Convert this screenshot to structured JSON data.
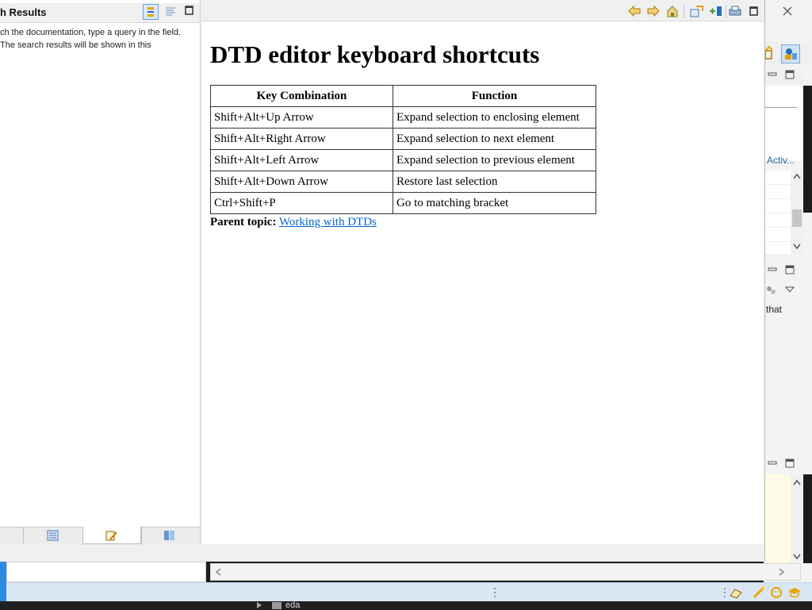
{
  "search_pane": {
    "title": "h Results",
    "info_text": "ch the documentation, type a query in the field. The search results will be shown in this"
  },
  "content": {
    "title": "DTD editor keyboard shortcuts",
    "table": {
      "headers": [
        "Key Combination",
        "Function"
      ],
      "rows": [
        [
          "Shift+Alt+Up Arrow",
          "Expand selection to enclosing element"
        ],
        [
          "Shift+Alt+Right Arrow",
          "Expand selection to next element"
        ],
        [
          "Shift+Alt+Left Arrow",
          "Expand selection to previous element"
        ],
        [
          "Shift+Alt+Down Arrow",
          "Restore last selection"
        ],
        [
          "Ctrl+Shift+P",
          "Go to matching bracket"
        ]
      ]
    },
    "parent_topic_label": "Parent topic:",
    "parent_topic_link": "Working with DTDs"
  },
  "background_ide": {
    "partial_link": "Activ...",
    "partial_text": "that"
  },
  "taskbar": {
    "label": "eda"
  },
  "icons": {
    "back": "back-arrow-icon",
    "forward": "forward-arrow-icon",
    "home": "home-icon",
    "sync": "sync-toc-icon",
    "bookmark": "add-bookmark-icon",
    "print": "print-icon",
    "maximize": "maximize-icon",
    "close": "close-icon"
  },
  "colors": {
    "link": "#0066cc",
    "accent_blue": "#2f8be0",
    "toolbar_orange": "#e8a400"
  }
}
